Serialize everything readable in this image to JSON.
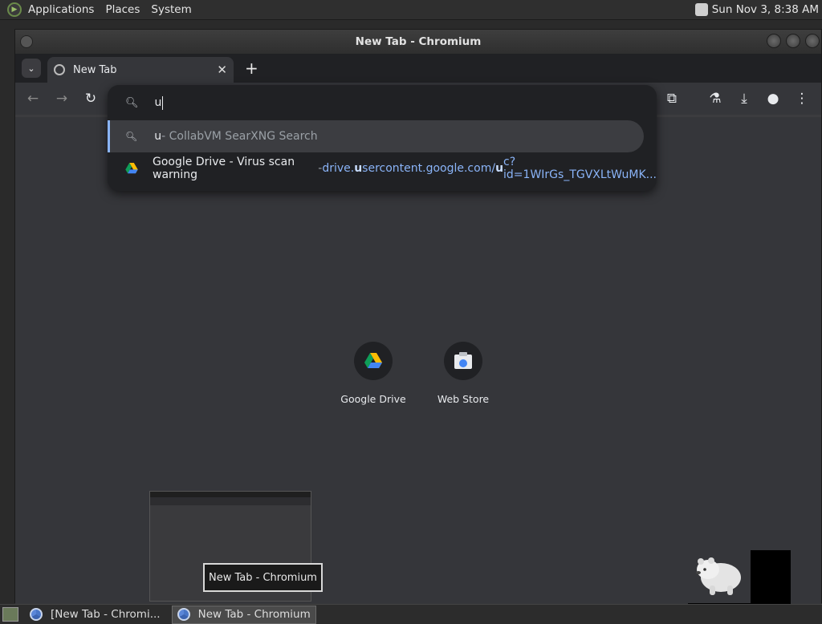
{
  "panel": {
    "applications": "Applications",
    "places": "Places",
    "system": "System",
    "clock": "Sun Nov  3,  8:38 AM"
  },
  "window": {
    "title": "New Tab - Chromium"
  },
  "tabs": [
    {
      "label": "New Tab"
    }
  ],
  "omnibox": {
    "input_value": "u",
    "suggestions": [
      {
        "match": "u",
        "rest": " - CollabVM SearXNG Search"
      },
      {
        "title": "Google Drive - Virus scan warning",
        "separator": " - ",
        "url_pre": "drive.",
        "url_match": "u",
        "url_post": "sercontent.google.com/",
        "url_match2": "u",
        "url_post2": "c?id=1WIrGs_TGVXLtWuMK..."
      }
    ]
  },
  "shortcuts": [
    {
      "label": "Google Drive"
    },
    {
      "label": "Web Store"
    }
  ],
  "tooltip": "New Tab - Chromium",
  "taskbar": {
    "items": [
      {
        "label": "[New Tab - Chromi..."
      },
      {
        "label": "New Tab - Chromium"
      }
    ]
  },
  "colors": {
    "accent": "#8ab4f8",
    "toolbar": "#35363a",
    "omnibox_bg": "#202124"
  }
}
